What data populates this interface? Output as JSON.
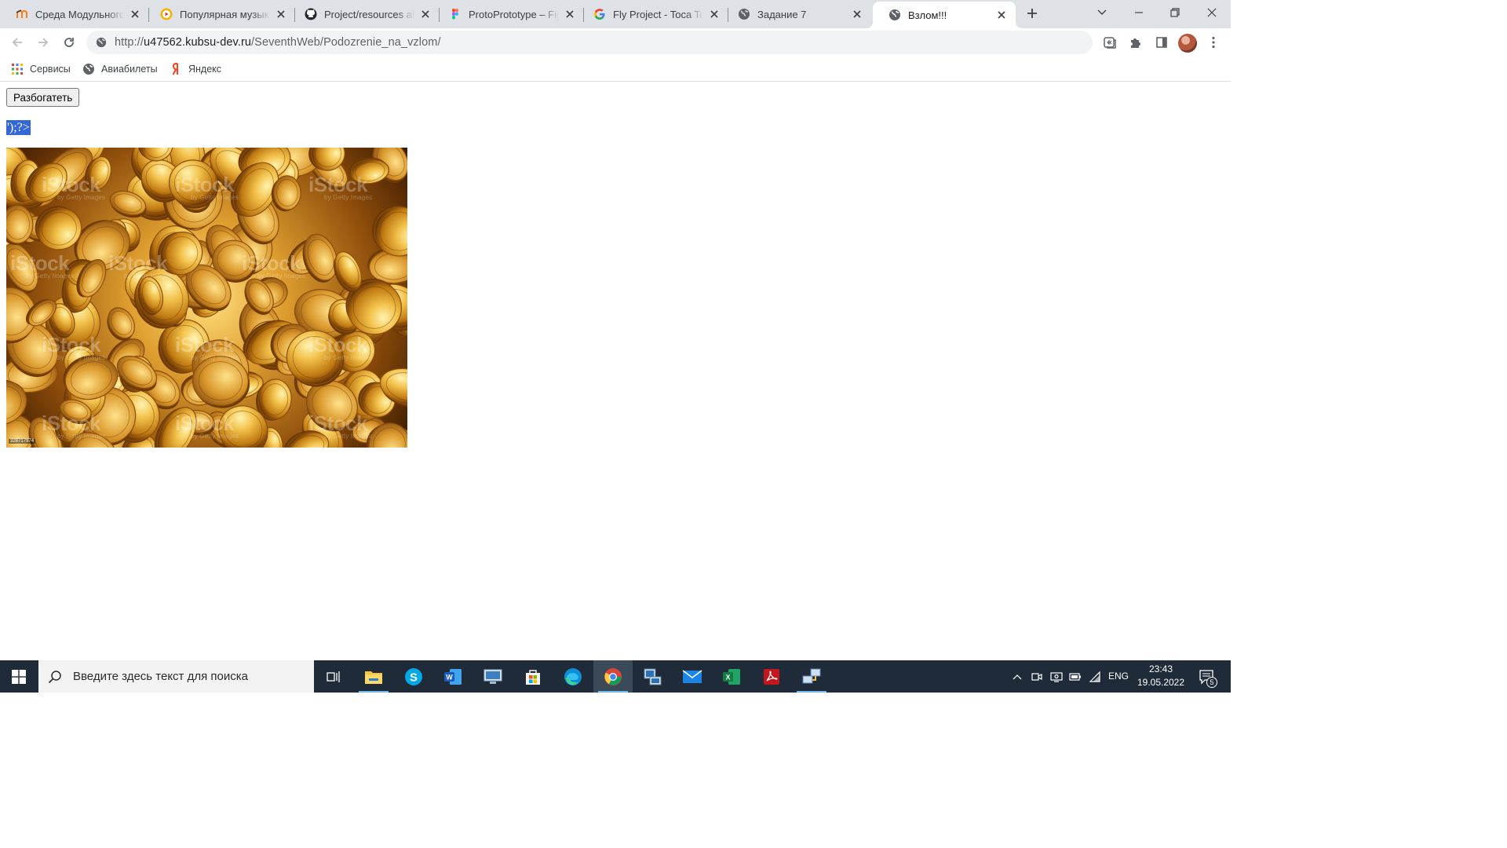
{
  "browser": {
    "tabs": [
      {
        "title": "Среда Модульного Д",
        "icon": "moodle-icon",
        "active": false
      },
      {
        "title": "Популярная музыка",
        "icon": "youtube-music-icon",
        "active": false
      },
      {
        "title": "Project/resources at p",
        "icon": "github-icon",
        "active": false
      },
      {
        "title": "ProtoPrototype – Figm",
        "icon": "figma-icon",
        "active": false
      },
      {
        "title": "Fly Project - Toca Toca",
        "icon": "google-icon",
        "active": false
      },
      {
        "title": "Задание 7",
        "icon": "globe-icon",
        "active": false
      },
      {
        "title": "Взлом!!!",
        "icon": "globe-icon",
        "active": true
      }
    ],
    "address": {
      "scheme": "http://",
      "host": "u47562.kubsu-dev.ru",
      "path": "/SeventhWeb/Podozrenie_na_vzlom/"
    },
    "bookmarks": [
      {
        "label": "Сервисы",
        "icon": "apps-grid-icon"
      },
      {
        "label": "Авиабилеты",
        "icon": "globe-icon"
      },
      {
        "label": "Яндекс",
        "icon": "yandex-icon"
      }
    ]
  },
  "page": {
    "button_label": "Разбогатеть",
    "leaked_text": "');?>",
    "image_caption": "gold coins stock photo"
  },
  "taskbar": {
    "search_placeholder": "Введите здесь текст для поиска",
    "language": "ENG",
    "time": "23:43",
    "date": "19.05.2022",
    "notifications_count": "5"
  },
  "colors": {
    "tabstrip_bg": "#dee1e6",
    "selection_blue": "#3367d6",
    "taskbar_bg": "#1f2b38"
  }
}
